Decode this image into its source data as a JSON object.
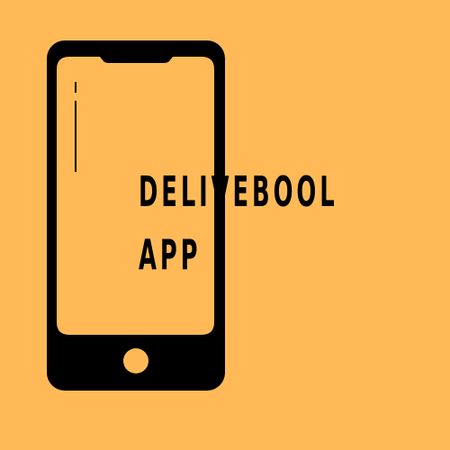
{
  "logo": {
    "name_line_1": "DELIVEBOOL",
    "name_line_2": "APP",
    "background_color": "#FFBA57",
    "ink_color": "#000000",
    "icon": "smartphone-icon"
  }
}
